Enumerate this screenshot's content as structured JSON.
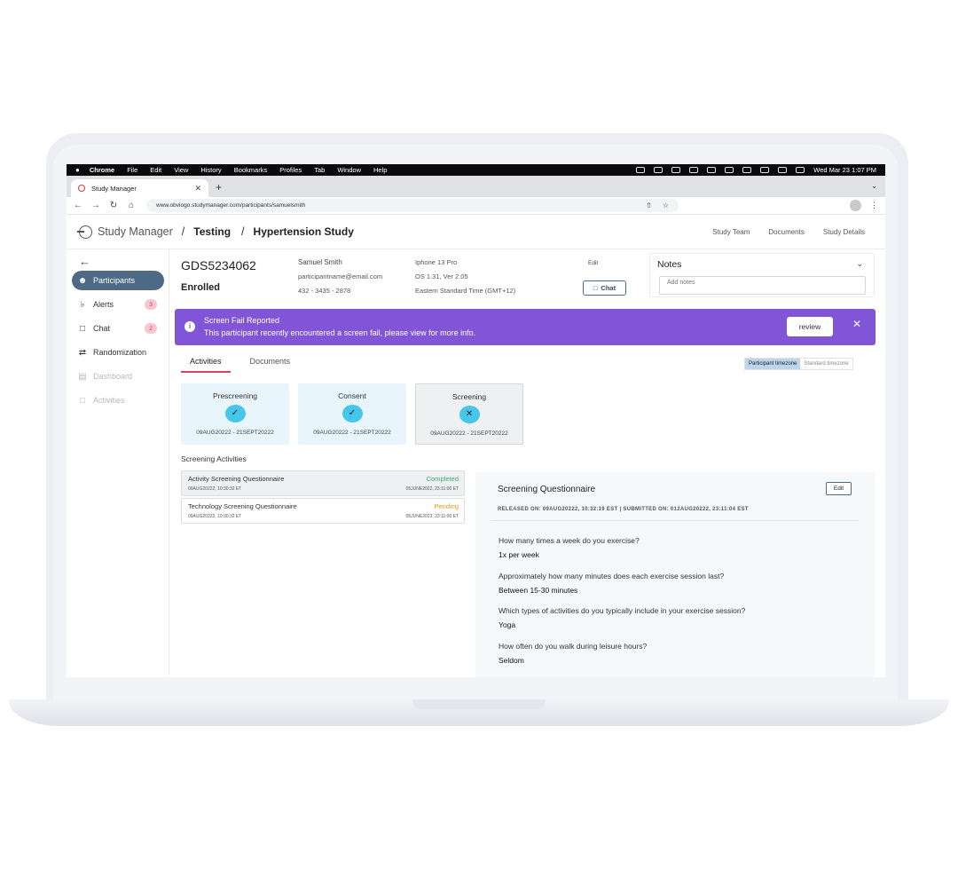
{
  "menubar": {
    "apple": "",
    "items": [
      "Chrome",
      "File",
      "Edit",
      "View",
      "History",
      "Bookmarks",
      "Profiles",
      "Tab",
      "Window",
      "Help"
    ],
    "datetime": "Wed Mar 23  1:07 PM"
  },
  "browser": {
    "tab_title": "Study Manager",
    "url": "www.obviogo.studymanager.com/participants/samuelsmith"
  },
  "header": {
    "brand": "Study Manager",
    "sep": "/",
    "crumb_1": "Testing",
    "crumb_2": "Hypertension Study",
    "links": [
      "Study Team",
      "Documents",
      "Study Details"
    ]
  },
  "sidebar": {
    "items": [
      {
        "label": "Participants",
        "icon": "people-icon"
      },
      {
        "label": "Alerts",
        "badge": "3",
        "icon": "bell-icon"
      },
      {
        "label": "Chat",
        "badge": "2",
        "icon": "chat-icon"
      },
      {
        "label": "Randomization",
        "icon": "shuffle-icon"
      },
      {
        "label": "Dashboard",
        "icon": "chart-icon"
      },
      {
        "label": "Activities",
        "icon": "bookmark-icon"
      }
    ]
  },
  "participant": {
    "id": "GDS5234062",
    "status": "Enrolled",
    "name": "Samuel Smith",
    "email": "participantname@email.com",
    "phone": "432 - 3435 - 2878",
    "device": "Iphone 13 Pro",
    "os": "OS 1.31, Ver 2.05",
    "timezone": "Eastern Standard Time (GMT+12)",
    "edit": "Edit",
    "chat": "Chat"
  },
  "notes": {
    "title": "Notes",
    "placeholder": "Add notes"
  },
  "alert": {
    "title": "Screen Fail Reported",
    "text": "This participant recently encountered a screen fail, please view for more info.",
    "button": "review",
    "color": "#8155d6"
  },
  "tabs": [
    "Activities",
    "Documents"
  ],
  "timezone_toggle": [
    "Participant timezone",
    "Standard timezone"
  ],
  "stages": [
    {
      "name": "Prescreening",
      "dates": "09AUG20222 - 21SEPT20222",
      "state": "complete"
    },
    {
      "name": "Consent",
      "dates": "09AUG20222 - 21SEPT20222",
      "state": "complete"
    },
    {
      "name": "Screening",
      "dates": "09AUG20222 - 21SEPT20222",
      "state": "failed"
    }
  ],
  "screening_activities": {
    "title": "Screening Activities",
    "items": [
      {
        "name": "Activity Screening Questionnaire",
        "released": "09AUG20222, 10:30:32 ET",
        "status": "Completed",
        "submitted": "05JUNE2022, 23:11:00 ET"
      },
      {
        "name": "Technology Screening Questionnaire",
        "released": "09AUG20222, 10:30:32 ET",
        "status": "Pending",
        "submitted": "05JUNE2022, 23:11:00 ET"
      }
    ]
  },
  "questionnaire": {
    "title": "Screening Questionnaire",
    "edit": "Edit",
    "meta": "RELEASED ON: 09AUG20222, 10:32:19 EST  |  SUBMITTED ON: 012AUG20222, 23:11:04 EST",
    "qa": [
      {
        "q": "How many times a week do you exercise?",
        "a": "1x per week"
      },
      {
        "q": "Approximately how many minutes does each exercise session last?",
        "a": "Between 15-30 minutes"
      },
      {
        "q": "Which types of activities do you typically include in your exercise session?",
        "a": "Yoga"
      },
      {
        "q": "How often do you walk during leisure hours?",
        "a": "Seldom"
      }
    ]
  },
  "colors": {
    "completed": "#3aa76d",
    "pending": "#e39a1c",
    "sidebar_active": "#4d6a87",
    "stage_check": "#46c6ea"
  }
}
